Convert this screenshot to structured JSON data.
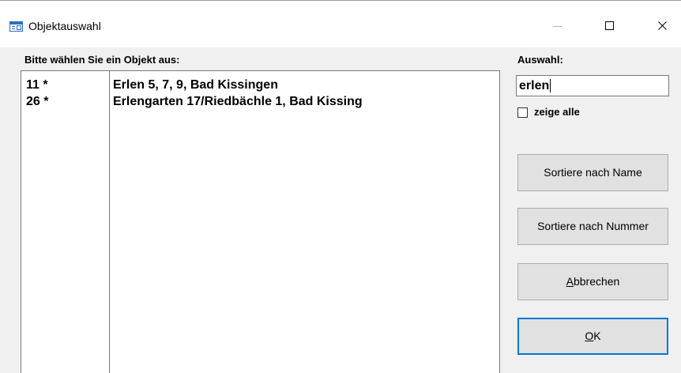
{
  "window": {
    "title": "Objektauswahl"
  },
  "list": {
    "prompt": "Bitte wählen Sie ein Objekt aus:",
    "rows": [
      {
        "number": "11 *",
        "name": "Erlen 5, 7, 9, Bad Kissingen"
      },
      {
        "number": "26 *",
        "name": "Erlengarten 17/Riedbächle 1, Bad Kissing"
      }
    ]
  },
  "filter": {
    "label": "Auswahl:",
    "value": "erlen",
    "show_all_label": "zeige alle",
    "show_all_checked": false
  },
  "buttons": {
    "sort_name": "Sortiere nach Name",
    "sort_number": "Sortiere nach Nummer",
    "cancel_access": "A",
    "cancel_rest": "bbrechen",
    "ok_access": "O",
    "ok_rest": "K"
  },
  "colors": {
    "accent": "#0078d7",
    "client_bg": "#f0f0f0",
    "button_bg": "#e1e1e1"
  }
}
